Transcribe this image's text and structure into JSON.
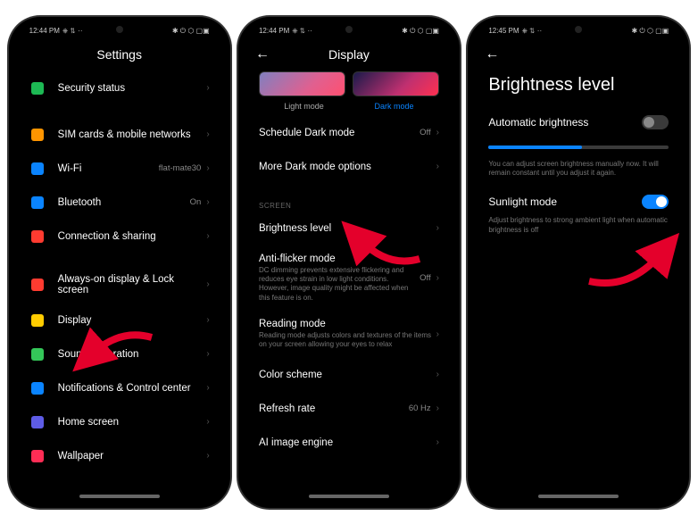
{
  "status": {
    "time1": "12:44 PM",
    "time2": "12:44 PM",
    "time3": "12:45 PM",
    "indicators_left": "⎈ ⇅ ··",
    "indicators_right": "✱ ⏻ ⬡ ▢▣"
  },
  "screen1": {
    "title": "Settings",
    "items": [
      {
        "icon": "shield-icon",
        "color": "#1db954",
        "label": "Security status",
        "value": ""
      },
      {
        "gap": true
      },
      {
        "icon": "sim-icon",
        "color": "#ff9500",
        "label": "SIM cards & mobile networks",
        "value": ""
      },
      {
        "icon": "wifi-icon",
        "color": "#0a84ff",
        "label": "Wi-Fi",
        "value": "flat-mate30"
      },
      {
        "icon": "bluetooth-icon",
        "color": "#0a84ff",
        "label": "Bluetooth",
        "value": "On"
      },
      {
        "icon": "link-icon",
        "color": "#ff3b30",
        "label": "Connection & sharing",
        "value": ""
      },
      {
        "gap": true
      },
      {
        "icon": "lock-icon",
        "color": "#ff3b30",
        "label": "Always-on display & Lock screen",
        "value": ""
      },
      {
        "icon": "sun-icon",
        "color": "#ffcc00",
        "label": "Display",
        "value": ""
      },
      {
        "icon": "sound-icon",
        "color": "#34c759",
        "label": "Sound & vibration",
        "value": ""
      },
      {
        "icon": "notif-icon",
        "color": "#0a84ff",
        "label": "Notifications & Control center",
        "value": ""
      },
      {
        "icon": "home-icon",
        "color": "#5e5ce6",
        "label": "Home screen",
        "value": ""
      },
      {
        "icon": "wallpaper-icon",
        "color": "#ff2d55",
        "label": "Wallpaper",
        "value": ""
      }
    ]
  },
  "screen2": {
    "title": "Display",
    "mode_light": "Light mode",
    "mode_dark": "Dark mode",
    "rows": [
      {
        "label": "Schedule Dark mode",
        "value": "Off",
        "desc": ""
      },
      {
        "label": "More Dark mode options",
        "value": "",
        "desc": ""
      }
    ],
    "section": "Screen",
    "rows2": [
      {
        "label": "Brightness level",
        "value": "",
        "desc": ""
      },
      {
        "label": "Anti-flicker mode",
        "value": "Off",
        "desc": "DC dimming prevents extensive flickering and reduces eye strain in low light conditions. However, image quality might be affected when this feature is on."
      },
      {
        "label": "Reading mode",
        "value": "",
        "desc": "Reading mode adjusts colors and textures of the items on your screen allowing your eyes to relax"
      },
      {
        "label": "Color scheme",
        "value": "",
        "desc": ""
      },
      {
        "label": "Refresh rate",
        "value": "60 Hz",
        "desc": ""
      },
      {
        "label": "AI image engine",
        "value": "",
        "desc": ""
      }
    ]
  },
  "screen3": {
    "title": "Brightness level",
    "auto_label": "Automatic brightness",
    "auto_on": false,
    "slider_pct": 52,
    "caption": "You can adjust screen brightness manually now. It will remain constant until you adjust it again.",
    "sunlight_label": "Sunlight mode",
    "sunlight_on": true,
    "caption2": "Adjust brightness to strong ambient light when automatic brightness is off"
  }
}
